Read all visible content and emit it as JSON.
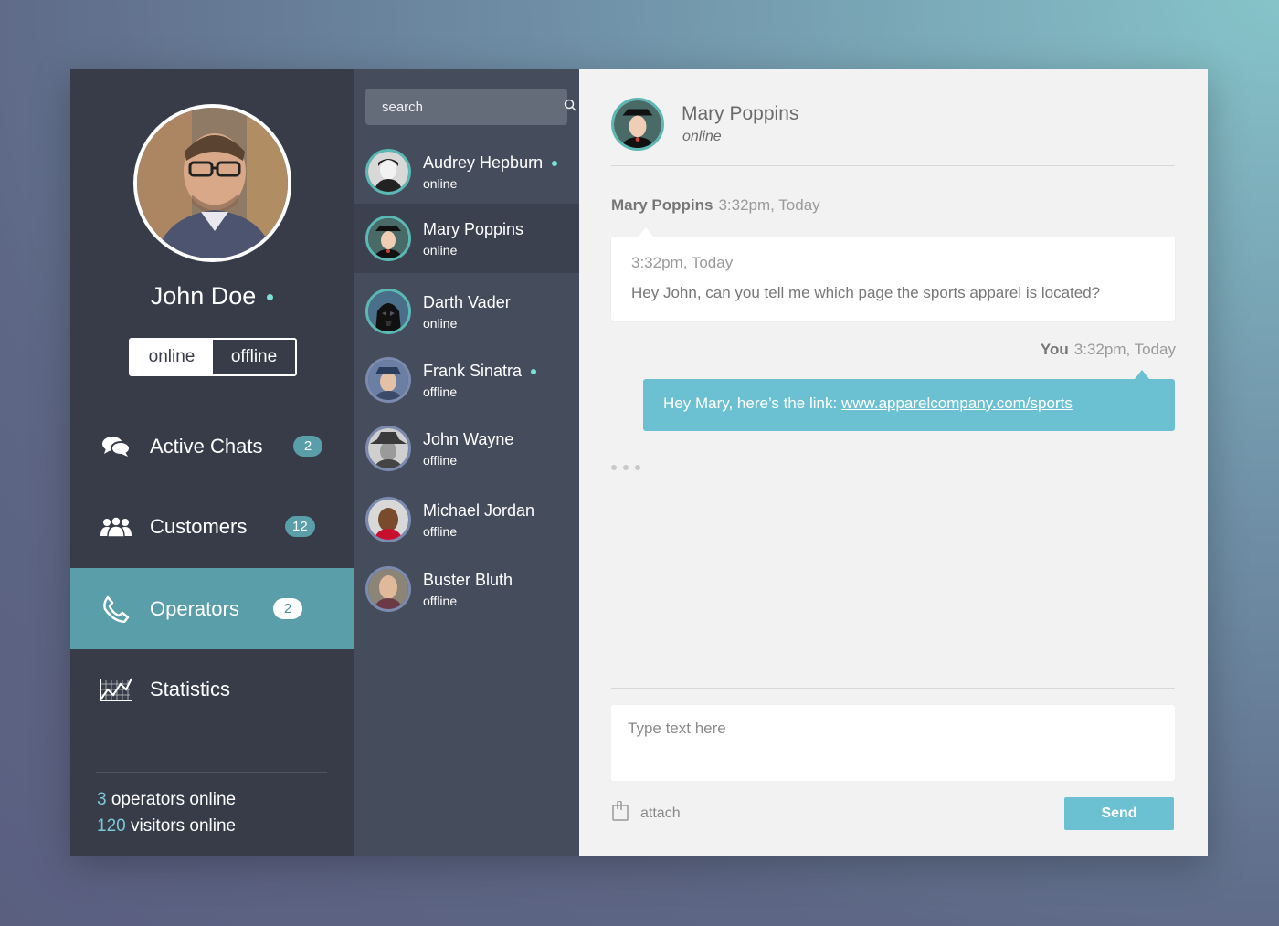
{
  "profile": {
    "name": "John Doe",
    "status_options": [
      "online",
      "offline"
    ],
    "selected_status": "online"
  },
  "nav": {
    "items": [
      {
        "label": "Active Chats",
        "badge": "2",
        "icon": "chat-bubbles-icon"
      },
      {
        "label": "Customers",
        "badge": "12",
        "icon": "people-icon"
      },
      {
        "label": "Operators",
        "badge": "2",
        "icon": "phone-icon",
        "active": true
      },
      {
        "label": "Statistics",
        "badge": "",
        "icon": "chart-icon"
      }
    ]
  },
  "footer": {
    "operators_count": "3",
    "operators_label": " operators online",
    "visitors_count": "120",
    "visitors_label": " visitors online"
  },
  "search": {
    "placeholder": "search"
  },
  "contacts": [
    {
      "name": "Audrey Hepburn",
      "status": "online",
      "dot": true
    },
    {
      "name": "Mary Poppins",
      "status": "online",
      "dot": false,
      "active": true
    },
    {
      "name": "Darth Vader",
      "status": "online",
      "dot": false
    },
    {
      "name": "Frank Sinatra",
      "status": "offline",
      "dot": true
    },
    {
      "name": "John Wayne",
      "status": "offline",
      "dot": false
    },
    {
      "name": "Michael Jordan",
      "status": "offline",
      "dot": false
    },
    {
      "name": "Buster Bluth",
      "status": "offline",
      "dot": false
    }
  ],
  "chat": {
    "contact_name": "Mary Poppins",
    "contact_status": "online",
    "messages": [
      {
        "sender": "Mary Poppins",
        "meta_time": "3:32pm, Today",
        "inner_time": "3:32pm, Today",
        "text": "Hey John, can you tell me which page the sports apparel is located?"
      },
      {
        "sender": "You",
        "meta_time": "3:32pm, Today",
        "text_prefix": "Hey Mary, here’s the link: ",
        "link": "www.apparelcompany.com/sports"
      }
    ]
  },
  "composer": {
    "placeholder": "Type text here",
    "attach_label": "attach",
    "send_label": "Send"
  },
  "colors": {
    "accent": "#6bc1d1",
    "active_nav": "#5a9ea9",
    "online_dot": "#7ce0d8",
    "sidebar_bg": "#373c48",
    "contacts_bg": "#454c5c"
  }
}
